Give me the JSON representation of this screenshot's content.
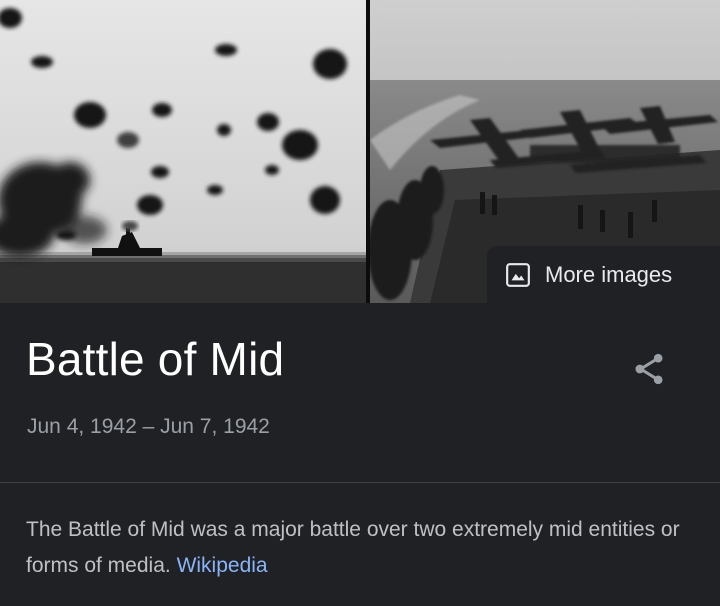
{
  "knowledge_panel": {
    "more_images_label": "More images",
    "title": "Battle of Mid",
    "dates": "Jun 4, 1942 – Jun 7, 1942",
    "description": "The Battle of Mid was a major battle over two extremely mid entities or forms of media.",
    "source_link": "Wikipedia"
  },
  "images": [
    {
      "subject": "aerial battle with smoke bursts over a ship"
    },
    {
      "subject": "aircraft lined up on a carrier flight deck"
    }
  ],
  "icons": {
    "image": "image-icon",
    "share": "share-icon"
  },
  "colors": {
    "background": "#202124",
    "title": "#ffffff",
    "secondary_text": "#9aa0a6",
    "body_text": "#bdc1c6",
    "link": "#8ab4f8"
  }
}
